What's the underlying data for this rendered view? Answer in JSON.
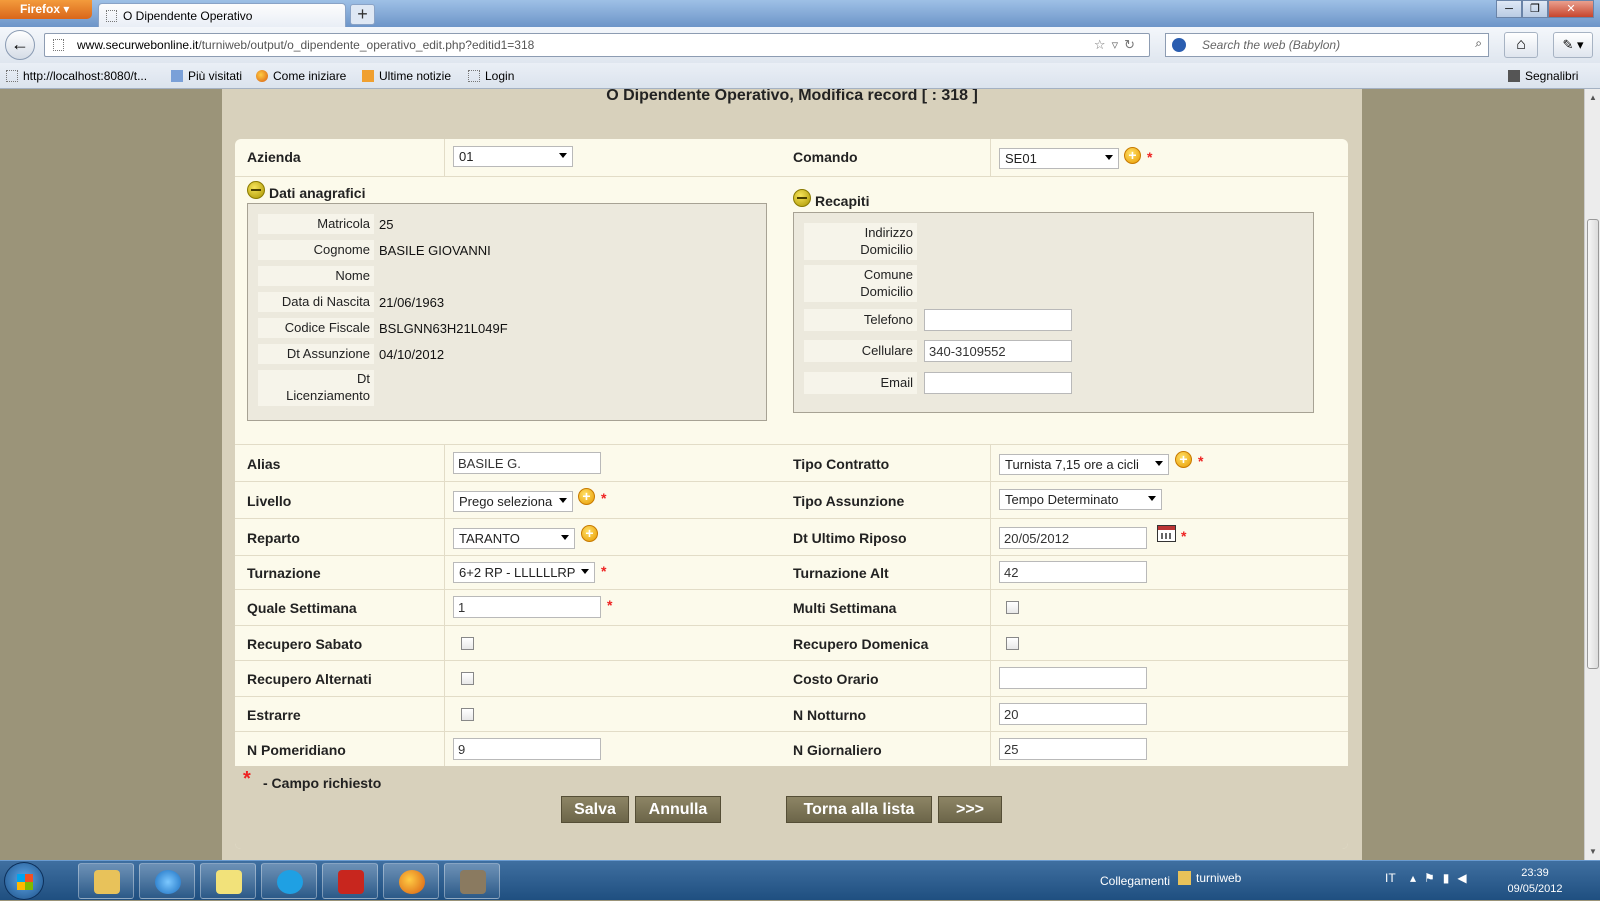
{
  "browser": {
    "app_button": "Firefox",
    "tab_title": "O Dipendente Operativo",
    "url_domain": "www.securwebonline.it",
    "url_path": "/turniweb/output/o_dipendente_operativo_edit.php?editid1=318",
    "search_placeholder": "Search the web (Babylon)",
    "bookmarks": [
      "http://localhost:8080/t...",
      "Più visitati",
      "Come iniziare",
      "Ultime notizie",
      "Login"
    ],
    "bookmarks_menu": "Segnalibri"
  },
  "page": {
    "title": "O Dipendente Operativo, Modifica record [ : 318 ]"
  },
  "form": {
    "azienda": {
      "label": "Azienda",
      "value": "01"
    },
    "comando": {
      "label": "Comando",
      "value": "SE01"
    },
    "dati_anagrafici": {
      "title": "Dati anagrafici",
      "rows": [
        {
          "label": "Matricola",
          "value": "25"
        },
        {
          "label": "Cognome",
          "value": "BASILE GIOVANNI"
        },
        {
          "label": "Nome",
          "value": ""
        },
        {
          "label": "Data di Nascita",
          "value": "21/06/1963"
        },
        {
          "label": "Codice Fiscale",
          "value": "BSLGNN63H21L049F"
        },
        {
          "label": "Dt Assunzione",
          "value": "04/10/2012"
        }
      ],
      "licenziamento_label_1": "Dt",
      "licenziamento_label_2": "Licenziamento"
    },
    "recapiti": {
      "title": "Recapiti",
      "indirizzo_1": "Indirizzo",
      "indirizzo_2": "Domicilio",
      "comune_1": "Comune",
      "comune_2": "Domicilio",
      "telefono": {
        "label": "Telefono",
        "value": ""
      },
      "cellulare": {
        "label": "Cellulare",
        "value": "340-3109552"
      },
      "email": {
        "label": "Email",
        "value": ""
      }
    },
    "alias": {
      "label": "Alias",
      "value": "BASILE G."
    },
    "tipo_contratto": {
      "label": "Tipo Contratto",
      "value": "Turnista 7,15 ore a cicli"
    },
    "livello": {
      "label": "Livello",
      "value": "Prego seleziona"
    },
    "tipo_assunzione": {
      "label": "Tipo Assunzione",
      "value": "Tempo Determinato"
    },
    "reparto": {
      "label": "Reparto",
      "value": "TARANTO"
    },
    "dt_ultimo_riposo": {
      "label": "Dt Ultimo Riposo",
      "value": "20/05/2012"
    },
    "turnazione": {
      "label": "Turnazione",
      "value": "6+2 RP - LLLLLLRP"
    },
    "turnazione_alt": {
      "label": "Turnazione Alt",
      "value": "42"
    },
    "quale_settimana": {
      "label": "Quale Settimana",
      "value": "1"
    },
    "multi_settimana": {
      "label": "Multi Settimana"
    },
    "recupero_sabato": {
      "label": "Recupero Sabato"
    },
    "recupero_domenica": {
      "label": "Recupero Domenica"
    },
    "recupero_alternati": {
      "label": "Recupero Alternati"
    },
    "costo_orario": {
      "label": "Costo Orario",
      "value": ""
    },
    "estrarre": {
      "label": "Estrarre"
    },
    "n_notturno": {
      "label": "N Notturno",
      "value": "20"
    },
    "n_pomeridiano": {
      "label": "N Pomeridiano",
      "value": "9"
    },
    "n_giornaliero": {
      "label": "N Giornaliero",
      "value": "25"
    },
    "required_note": "- Campo richiesto",
    "required_mark": "*",
    "plus_mark": "+"
  },
  "buttons": {
    "salva": "Salva",
    "annulla": "Annulla",
    "torna": "Torna alla lista",
    "next": ">>>"
  },
  "taskbar": {
    "tray_label": "Collegamenti",
    "folder_label": "turniweb",
    "lang": "IT",
    "time": "23:39",
    "date": "09/05/2012"
  }
}
